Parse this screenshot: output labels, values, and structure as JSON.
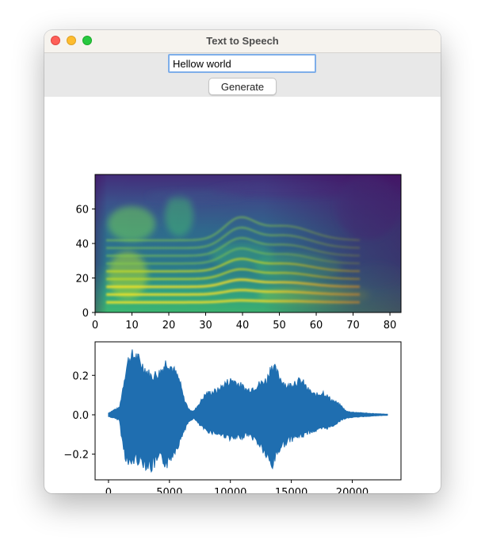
{
  "window": {
    "title": "Text to Speech"
  },
  "input": {
    "value": "Hellow world"
  },
  "toolbar": {
    "generate_label": "Generate"
  },
  "colors": {
    "waveform": "#1f6eb0",
    "viridis_low": "#440154",
    "viridis_high": "#fde725"
  },
  "chart_data": [
    {
      "type": "heatmap",
      "title": "",
      "xlabel": "",
      "ylabel": "",
      "xlim": [
        0,
        83
      ],
      "ylim": [
        0,
        80
      ],
      "x_ticks": [
        "0",
        "10",
        "20",
        "30",
        "40",
        "50",
        "60",
        "70",
        "80"
      ],
      "y_ticks": [
        "0",
        "20",
        "40",
        "60"
      ],
      "colormap": "viridis"
    },
    {
      "type": "line",
      "title": "",
      "xlabel": "",
      "ylabel": "",
      "xlim": [
        -1100,
        24000
      ],
      "ylim": [
        -0.33,
        0.37
      ],
      "x_ticks": [
        "0",
        "5000",
        "10000",
        "15000",
        "20000"
      ],
      "y_ticks": [
        "0.2",
        "0.0",
        "−0.2"
      ],
      "envelope": {
        "x": [
          0,
          500,
          900,
          1100,
          1400,
          1700,
          2200,
          2800,
          3500,
          4200,
          4800,
          5300,
          5800,
          6200,
          6600,
          7000,
          7500,
          8000,
          8500,
          9000,
          9600,
          10200,
          10800,
          11400,
          12000,
          12500,
          13000,
          13400,
          13800,
          14200,
          14700,
          15300,
          15900,
          16400,
          17000,
          17600,
          18200,
          18700,
          19100,
          19500,
          20000,
          20600,
          21400,
          22200,
          22900
        ],
        "upper": [
          0.01,
          0.03,
          0.04,
          0.12,
          0.25,
          0.33,
          0.34,
          0.28,
          0.22,
          0.24,
          0.31,
          0.26,
          0.2,
          0.09,
          0.03,
          0.02,
          0.07,
          0.12,
          0.13,
          0.14,
          0.18,
          0.2,
          0.17,
          0.14,
          0.16,
          0.18,
          0.2,
          0.29,
          0.24,
          0.2,
          0.16,
          0.19,
          0.19,
          0.14,
          0.11,
          0.13,
          0.09,
          0.07,
          0.05,
          0.02,
          0.015,
          0.012,
          0.008,
          0.005,
          0.003
        ],
        "lower": [
          -0.01,
          -0.02,
          -0.03,
          -0.14,
          -0.24,
          -0.29,
          -0.25,
          -0.27,
          -0.3,
          -0.25,
          -0.28,
          -0.22,
          -0.16,
          -0.09,
          -0.04,
          -0.02,
          -0.06,
          -0.09,
          -0.1,
          -0.11,
          -0.12,
          -0.14,
          -0.13,
          -0.11,
          -0.14,
          -0.18,
          -0.24,
          -0.3,
          -0.22,
          -0.18,
          -0.15,
          -0.13,
          -0.12,
          -0.1,
          -0.09,
          -0.08,
          -0.07,
          -0.05,
          -0.03,
          -0.02,
          -0.015,
          -0.012,
          -0.008,
          -0.005,
          -0.003
        ]
      }
    }
  ]
}
